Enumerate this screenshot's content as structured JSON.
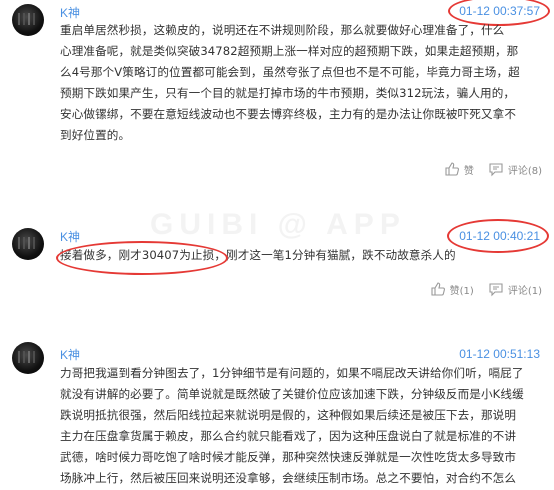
{
  "watermark": "GUIBI @ APP",
  "posts": [
    {
      "author": "K神",
      "time": "01-12 00:37:57",
      "lines": [
        "重启单居然秒损，这赖皮的，说明还在不讲规则阶段，那么就要做好心理准备了，什么",
        "心理准备呢，就是类似突破34782超预期上涨一样对应的超预期下跌，如果走超预期，那",
        "么4号那个V策略订的位置都可能会到，虽然夸张了点但也不是不可能，毕竟力哥主场，超",
        "预期下跌如果产生，只有一个目的就是打掉市场的牛市预期，类似312玩法，骗人用的，",
        "安心做镙绑，不要在意短线波动也不要去博弈终极，主力有的是办法让你既被吓死又拿不",
        "到好位置的。"
      ],
      "like_label": "赞",
      "comment_label": "评论(8)"
    },
    {
      "author": "K神",
      "time": "01-12 00:40:21",
      "lines": [
        "接着做多，刚才30407为止损，刚才这一笔1分钟有猫腻，跌不动故意杀人的"
      ],
      "like_label": "赞(1)",
      "comment_label": "评论(1)"
    },
    {
      "author": "K神",
      "time": "01-12 00:51:13",
      "lines": [
        "力哥把我逼到看分钟图去了，1分钟细节是有问题的，如果不嗝屁改天讲给你们听，嗝屁了",
        "就没有讲解的必要了。简单说就是既然破了关键价位应该加速下跌，分钟级反而是小K线缓",
        "跌说明抵抗很强，然后阳线拉起来就说明是假的，这种假如果后续还是被压下去，那说明",
        "主力在压盘拿货属于赖皮，那么合约就只能看戏了，因为这种压盘说白了就是标准的不讲",
        "武德，啥时候力哥吃饱了啥时候才能反弹，那种突然快速反弹就是一次性吃货太多导致市",
        "场脉冲上行，然后被压回来说明还没拿够，会继续压制市场。总之不要怕，对合约不怎么"
      ]
    }
  ]
}
